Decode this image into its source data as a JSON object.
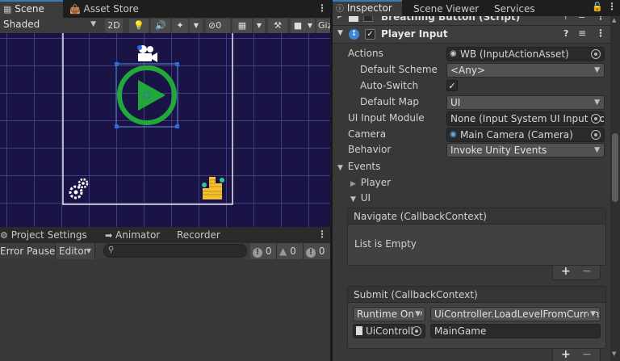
{
  "scene_tabs": {
    "scene": "Scene",
    "asset_store": "Asset Store"
  },
  "scene_toolbar": {
    "draw_mode": "Shaded",
    "two_d": "2D",
    "gizmo_count": "0",
    "gizmos": "Giz"
  },
  "bottom_tabs": {
    "project_settings": "Project Settings",
    "animator": "Animator",
    "recorder": "Recorder"
  },
  "console": {
    "error_pause": "Error Pause",
    "editor": "Editor",
    "search_placeholder": "",
    "errors": "0",
    "warnings": "0",
    "logs": "0"
  },
  "inspector_tabs": {
    "inspector": "Inspector",
    "scene_viewer": "Scene Viewer",
    "services": "Services"
  },
  "inspector": {
    "prev_component": "Breathing Button (Script)",
    "component_title": "Player Input",
    "component_enabled": true,
    "actions_label": "Actions",
    "actions_value": "WB (InputActionAsset)",
    "default_scheme_label": "Default Scheme",
    "default_scheme_value": "<Any>",
    "auto_switch_label": "Auto-Switch",
    "auto_switch_checked": true,
    "default_map_label": "Default Map",
    "default_map_value": "UI",
    "ui_input_module_label": "UI Input Module",
    "ui_input_module_value": "None (Input System UI Input Mo",
    "camera_label": "Camera",
    "camera_value": "Main Camera (Camera)",
    "behavior_label": "Behavior",
    "behavior_value": "Invoke Unity Events",
    "events_label": "Events",
    "player_label": "Player",
    "ui_label": "UI",
    "navigate": {
      "header": "Navigate (CallbackContext)",
      "empty_text": "List is Empty"
    },
    "submit": {
      "header": "Submit (CallbackContext)",
      "runtime": "Runtime Only",
      "function": "UiController.LoadLevelFromCurrent",
      "target": "UiControll",
      "argument": "MainGame"
    },
    "add": "+",
    "remove": "−"
  },
  "colors": {
    "accent": "#3a79bb",
    "scene_bg": "#1a1446",
    "play_green": "#22a83a",
    "gizmo_blue": "#2d6bd6"
  }
}
